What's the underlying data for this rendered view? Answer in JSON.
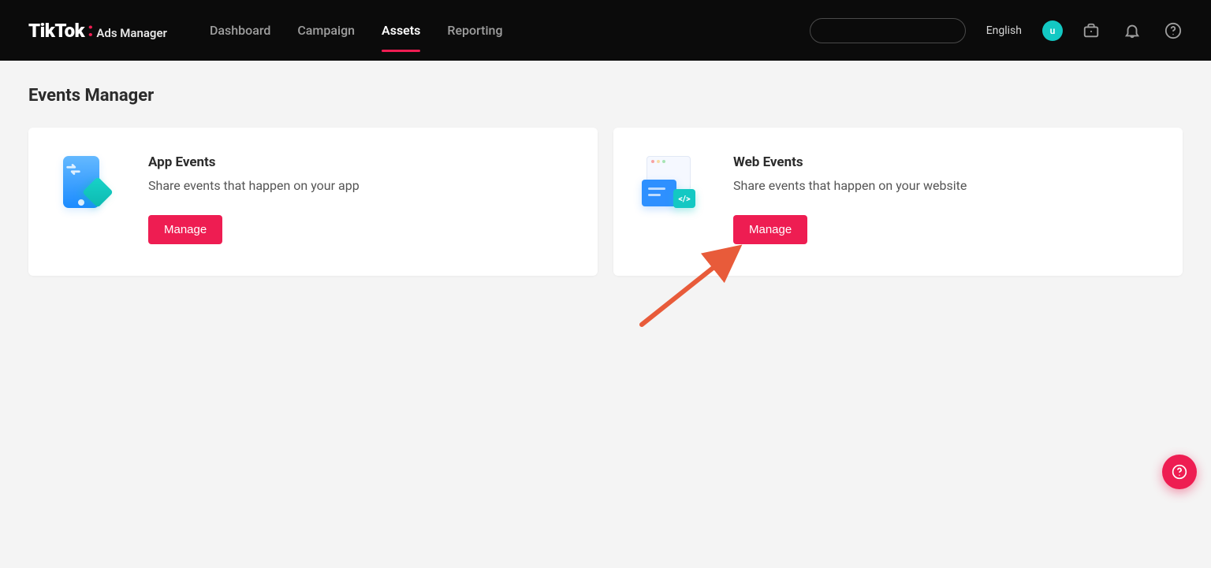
{
  "brand": {
    "wordmark": "TikTok",
    "suffix": "Ads Manager"
  },
  "nav": {
    "items": [
      {
        "label": "Dashboard",
        "active": false
      },
      {
        "label": "Campaign",
        "active": false
      },
      {
        "label": "Assets",
        "active": true
      },
      {
        "label": "Reporting",
        "active": false
      }
    ]
  },
  "header": {
    "language": "English",
    "avatar_initial": "u"
  },
  "page": {
    "title": "Events Manager"
  },
  "cards": [
    {
      "title": "App Events",
      "desc": "Share events that happen on your app",
      "button": "Manage",
      "icon": "app-events"
    },
    {
      "title": "Web Events",
      "desc": "Share events that happen on your website",
      "button": "Manage",
      "icon": "web-events"
    }
  ],
  "colors": {
    "accent": "#ee1d52",
    "teal": "#13c8c3",
    "blue": "#2e90ff"
  }
}
